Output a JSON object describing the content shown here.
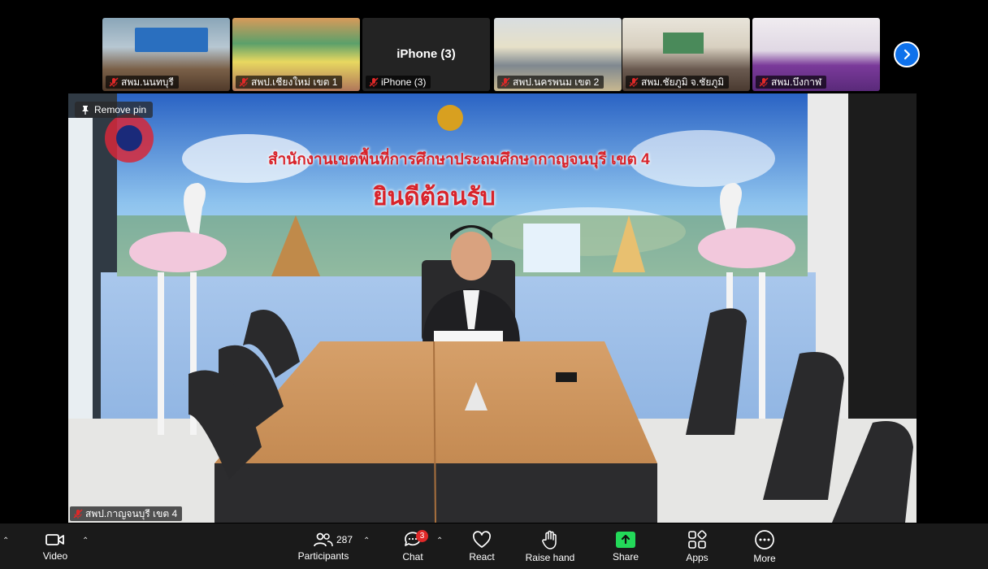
{
  "thumbnails": [
    {
      "name": "สพม.นนทบุรี",
      "muted": true
    },
    {
      "name": "สพป.เชียงใหม่ เขต 1",
      "muted": true
    },
    {
      "name": "iPhone (3)",
      "center_text": "iPhone (3)",
      "muted": true
    },
    {
      "name": "สพป.นครพนม เขต 2",
      "muted": true
    },
    {
      "name": "สพม.ชัยภูมิ จ.ชัยภูมิ",
      "muted": true
    },
    {
      "name": "สพม.บึงกาฬ",
      "muted": true
    }
  ],
  "pinned": {
    "remove_pin_label": "Remove pin",
    "name": "สพป.กาญจนบุรี เขต 4",
    "banner_title": "สำนักงานเขตพื้นที่การศึกษาประถมศึกษากาญจนบุรี เขต 4",
    "banner_welcome": "ยินดีต้อนรับ"
  },
  "toolbar": {
    "video_label": "Video",
    "participants_label": "Participants",
    "participants_count": "287",
    "chat_label": "Chat",
    "chat_badge": "3",
    "react_label": "React",
    "raise_hand_label": "Raise hand",
    "share_label": "Share",
    "apps_label": "Apps",
    "more_label": "More"
  },
  "colors": {
    "share_green": "#23d959",
    "accent_blue": "#0e71eb",
    "muted_red": "#e02828",
    "toolbar_bg": "#1a1a1a"
  }
}
